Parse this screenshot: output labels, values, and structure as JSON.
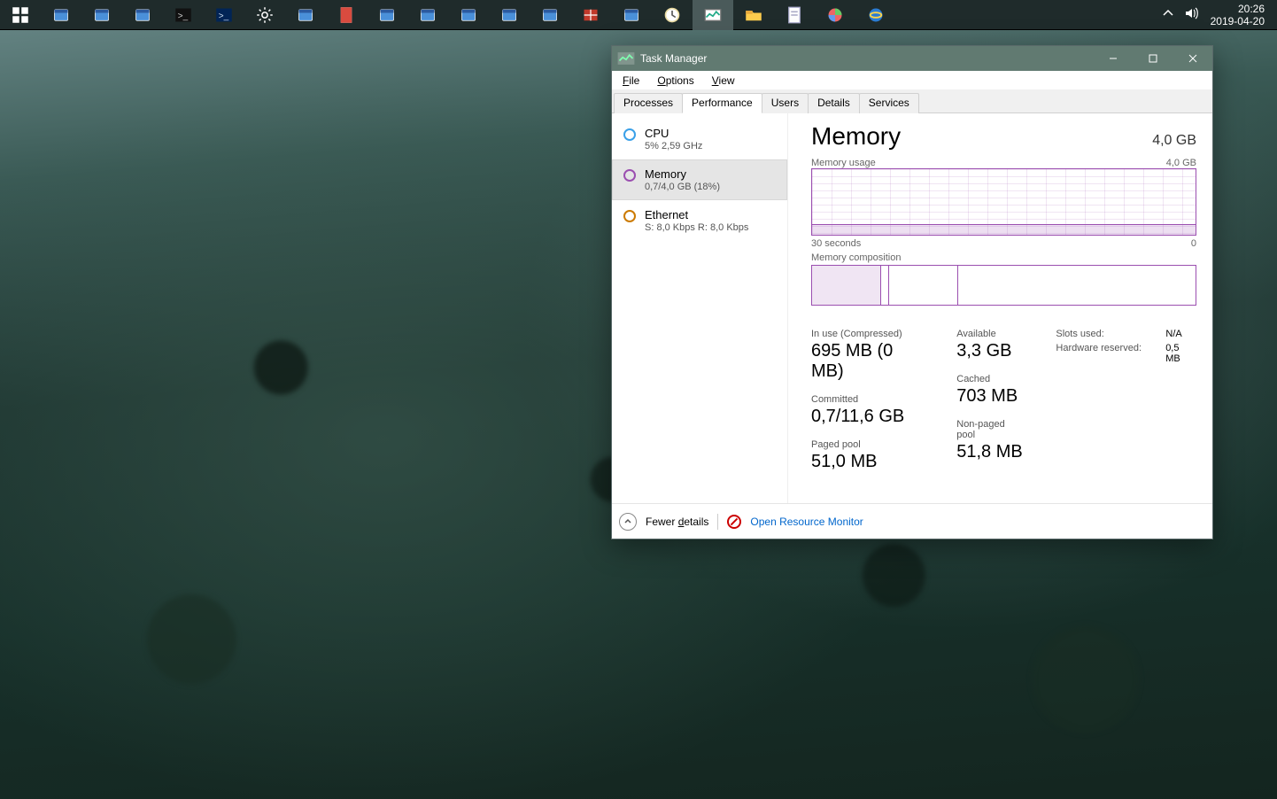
{
  "taskbar": {
    "time": "20:26",
    "date": "2019-04-20",
    "icons": [
      "start-icon",
      "server-mgr-icon",
      "server-mgr2-icon",
      "explorer-blue-icon",
      "cmd-icon",
      "powershell-icon",
      "settings-gear-icon",
      "network-icon",
      "pdf-icon",
      "viewer-icon",
      "screen-icon",
      "sysconfig-icon",
      "services-icon",
      "remote-icon",
      "firewall-icon",
      "defrag-icon",
      "clock-icon",
      "resource-monitor-icon",
      "file-explorer-icon",
      "notepad-icon",
      "disk-icon",
      "ie-icon"
    ],
    "active_index": 17
  },
  "window": {
    "title": "Task Manager",
    "menu": {
      "file": "File",
      "options": "Options",
      "view": "View"
    },
    "tabs": [
      "Processes",
      "Performance",
      "Users",
      "Details",
      "Services"
    ],
    "active_tab": 1,
    "sidebar": {
      "items": [
        {
          "name": "CPU",
          "sub": "5%  2,59 GHz",
          "color": "#3aa0e8"
        },
        {
          "name": "Memory",
          "sub": "0,7/4,0 GB (18%)",
          "color": "#9b4fb0"
        },
        {
          "name": "Ethernet",
          "sub": "S: 8,0 Kbps  R: 8,0 Kbps",
          "color": "#cc7a00"
        }
      ],
      "selected": 1
    },
    "detail": {
      "title": "Memory",
      "capacity": "4,0 GB",
      "usage_label": "Memory usage",
      "usage_max": "4,0 GB",
      "axis_left": "30 seconds",
      "axis_right": "0",
      "composition_label": "Memory composition",
      "stats": {
        "in_use_label": "In use (Compressed)",
        "in_use_value": "695 MB (0 MB)",
        "available_label": "Available",
        "available_value": "3,3 GB",
        "committed_label": "Committed",
        "committed_value": "0,7/11,6 GB",
        "cached_label": "Cached",
        "cached_value": "703 MB",
        "paged_label": "Paged pool",
        "paged_value": "51,0 MB",
        "nonpaged_label": "Non-paged pool",
        "nonpaged_value": "51,8 MB"
      },
      "kv": {
        "slots_label": "Slots used:",
        "slots_value": "N/A",
        "hw_label": "Hardware reserved:",
        "hw_value": "0,5 MB"
      }
    },
    "footer": {
      "fewer": "Fewer details",
      "resmon": "Open Resource Monitor"
    }
  },
  "chart_data": {
    "type": "line",
    "title": "Memory usage",
    "ylabel": "Memory",
    "ylim": [
      0,
      4.0
    ],
    "xlabel_left": "30 seconds",
    "xlabel_right": "0",
    "series": [
      {
        "name": "Memory usage (GB)",
        "values": [
          0.7,
          0.7,
          0.7,
          0.7,
          0.7,
          0.7,
          0.7,
          0.7,
          0.7,
          0.7,
          0.7,
          0.7,
          0.7,
          0.7,
          0.7,
          0.7,
          0.7,
          0.7,
          0.7,
          0.7,
          0.7,
          0.7,
          0.7,
          0.7,
          0.7,
          0.7,
          0.7,
          0.7,
          0.7,
          0.7
        ]
      }
    ],
    "composition": {
      "in_use_mb": 695,
      "modified_mb": 60,
      "standby_mb": 703,
      "free_mb": 2638,
      "total_mb": 4096
    }
  }
}
